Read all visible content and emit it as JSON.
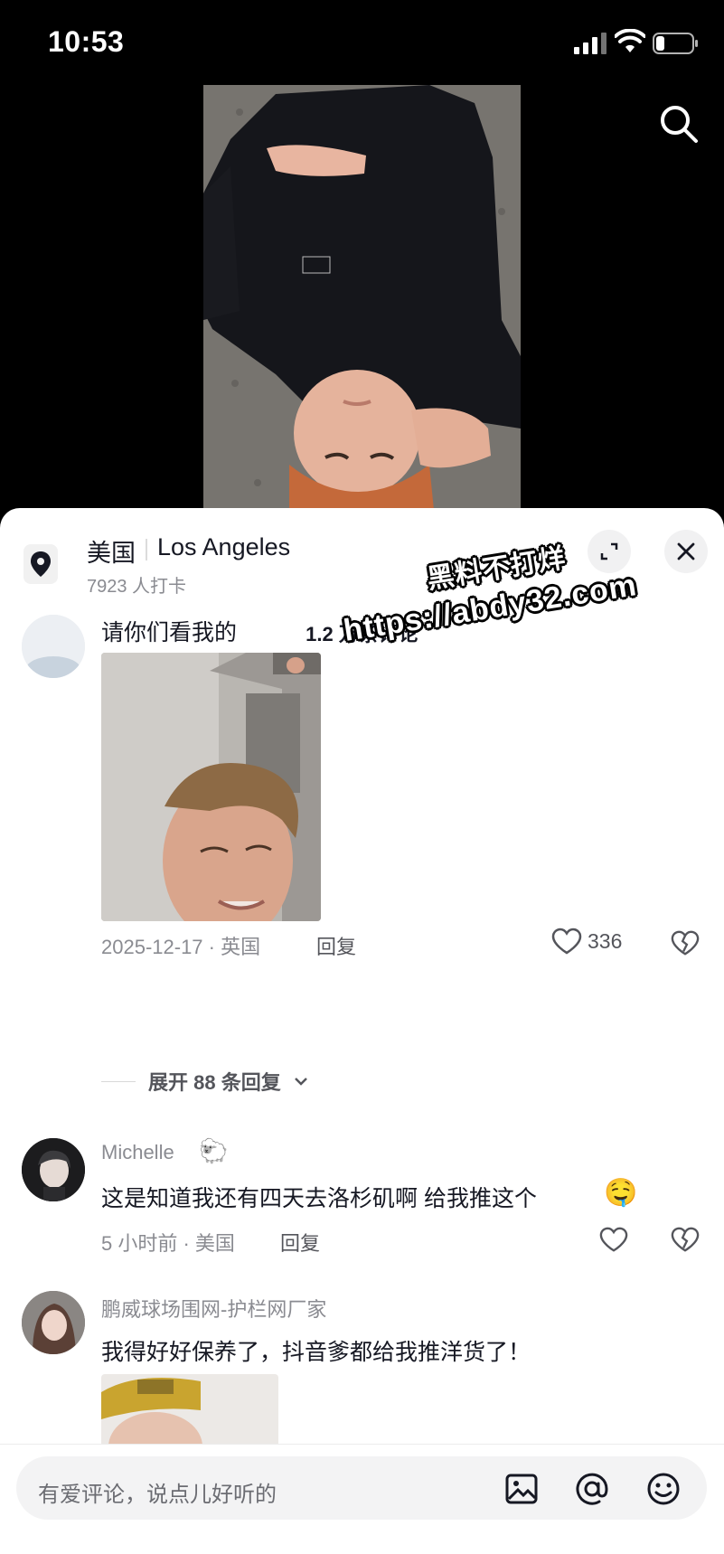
{
  "status_bar": {
    "time": "10:53"
  },
  "location": {
    "country": "美国",
    "city": "Los Angeles",
    "checkins": "7923 人打卡"
  },
  "comments_header": {
    "count": "1.2 万条评论"
  },
  "watermark": {
    "line1": "黑料不打烊",
    "line2": "https://abdy32.com"
  },
  "comments": [
    {
      "text": "请你们看我的",
      "date": "2025-12-17 · 英国",
      "reply": "回复",
      "likes": "336",
      "expand": "展开 88 条回复"
    },
    {
      "user": "Michelle",
      "text": "这是知道我还有四天去洛杉矶啊 给我推这个",
      "emoji": "🤤",
      "meta": "5 小时前 · 美国",
      "reply": "回复"
    },
    {
      "user": "鹏威球场围网-护栏网厂家",
      "text": "我得好好保养了，抖音爹都给我推洋货了！"
    }
  ],
  "input": {
    "placeholder": "有爱评论，说点儿好听的"
  },
  "icons": {
    "signal": "signal-icon",
    "wifi": "wifi-icon",
    "battery": "battery-icon",
    "search": "search-icon",
    "location": "location-pin-icon",
    "expand": "expand-icon",
    "close": "close-icon",
    "like": "heart-icon",
    "dislike": "broken-heart-icon",
    "chevron": "chevron-down-icon",
    "image": "image-icon",
    "mention": "at-icon",
    "emoji": "emoji-icon"
  }
}
